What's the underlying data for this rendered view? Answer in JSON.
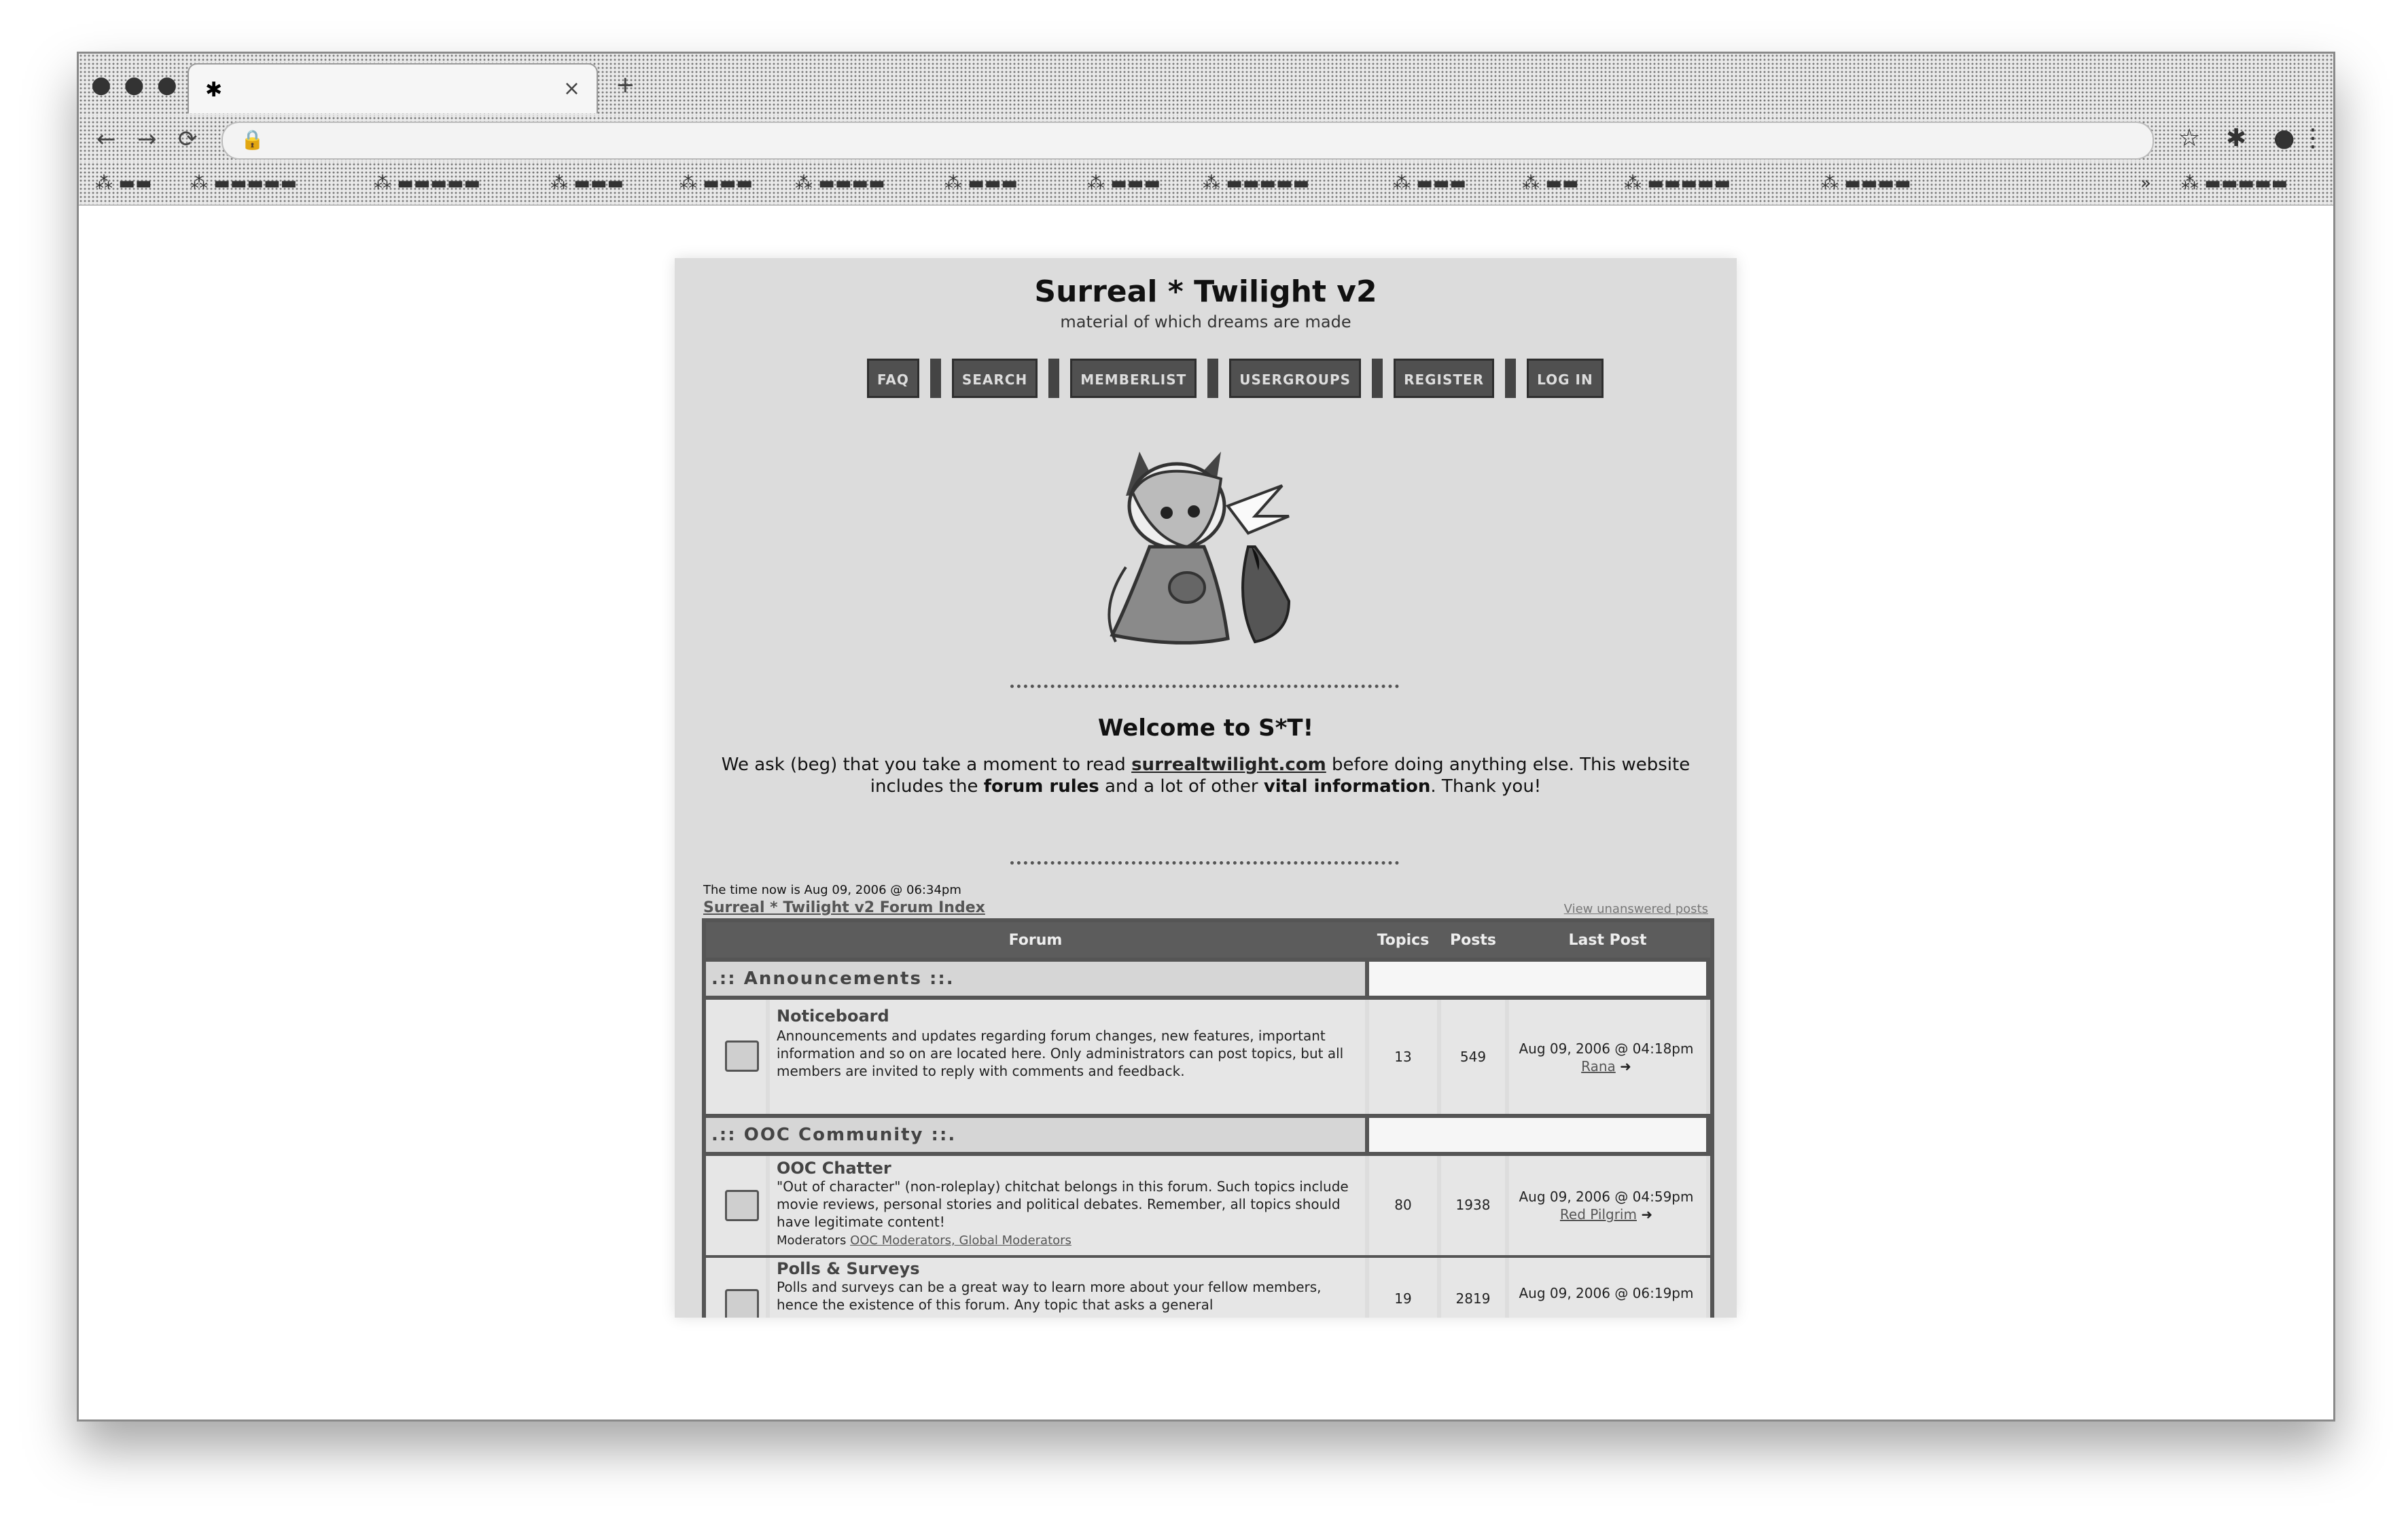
{
  "browser": {
    "tab_title": "",
    "url": "",
    "bookmarks": []
  },
  "site": {
    "title": "Surreal * Twilight v2",
    "subtitle": "material of which dreams are made",
    "nav": [
      "FAQ",
      "SEARCH",
      "MEMBERLIST",
      "USERGROUPS",
      "REGISTER",
      "LOG IN"
    ],
    "welcome": "Welcome to S*T!",
    "intro_before": "We ask (beg) that you take a moment to read ",
    "intro_link": "surrealtwilight.com",
    "intro_mid": " before doing anything else. This website includes the ",
    "intro_rules": "forum rules",
    "intro_and": " and a lot of other ",
    "intro_vital": "vital information",
    "intro_end": ". Thank you!",
    "time_now": "The time now is Aug 09, 2006 @ 06:34pm",
    "forum_index": "Surreal * Twilight v2 Forum Index",
    "unanswered": "View unanswered posts"
  },
  "table": {
    "headers": {
      "forum": "Forum",
      "topics": "Topics",
      "posts": "Posts",
      "last_post": "Last Post"
    },
    "categories": [
      ".:: Announcements ::.",
      ".:: OOC Community ::."
    ],
    "forums": [
      {
        "name": "Noticeboard",
        "desc": "Announcements and updates regarding forum changes, new features, important information and so on are located here. Only administrators can post topics, but all members are invited to reply with comments and feedback.",
        "mods_label": "",
        "mods": "",
        "topics": "13",
        "posts": "549",
        "last_date": "Aug 09, 2006 @ 04:18pm",
        "last_user": "Rana"
      },
      {
        "name": "OOC Chatter",
        "desc": "\"Out of character\" (non-roleplay) chitchat belongs in this forum. Such topics include movie reviews, personal stories and political debates. Remember, all topics should have legitimate content!",
        "mods_label": "Moderators",
        "mods": "OOC Moderators, Global Moderators",
        "topics": "80",
        "posts": "1938",
        "last_date": "Aug 09, 2006 @ 04:59pm",
        "last_user": "Red Pilgrim"
      },
      {
        "name": "Polls & Surveys",
        "desc": "Polls and surveys can be a great way to learn more about your fellow members, hence the existence of this forum. Any topic that asks a general",
        "mods_label": "",
        "mods": "",
        "topics": "19",
        "posts": "2819",
        "last_date": "Aug 09, 2006 @ 06:19pm",
        "last_user": ""
      }
    ]
  }
}
